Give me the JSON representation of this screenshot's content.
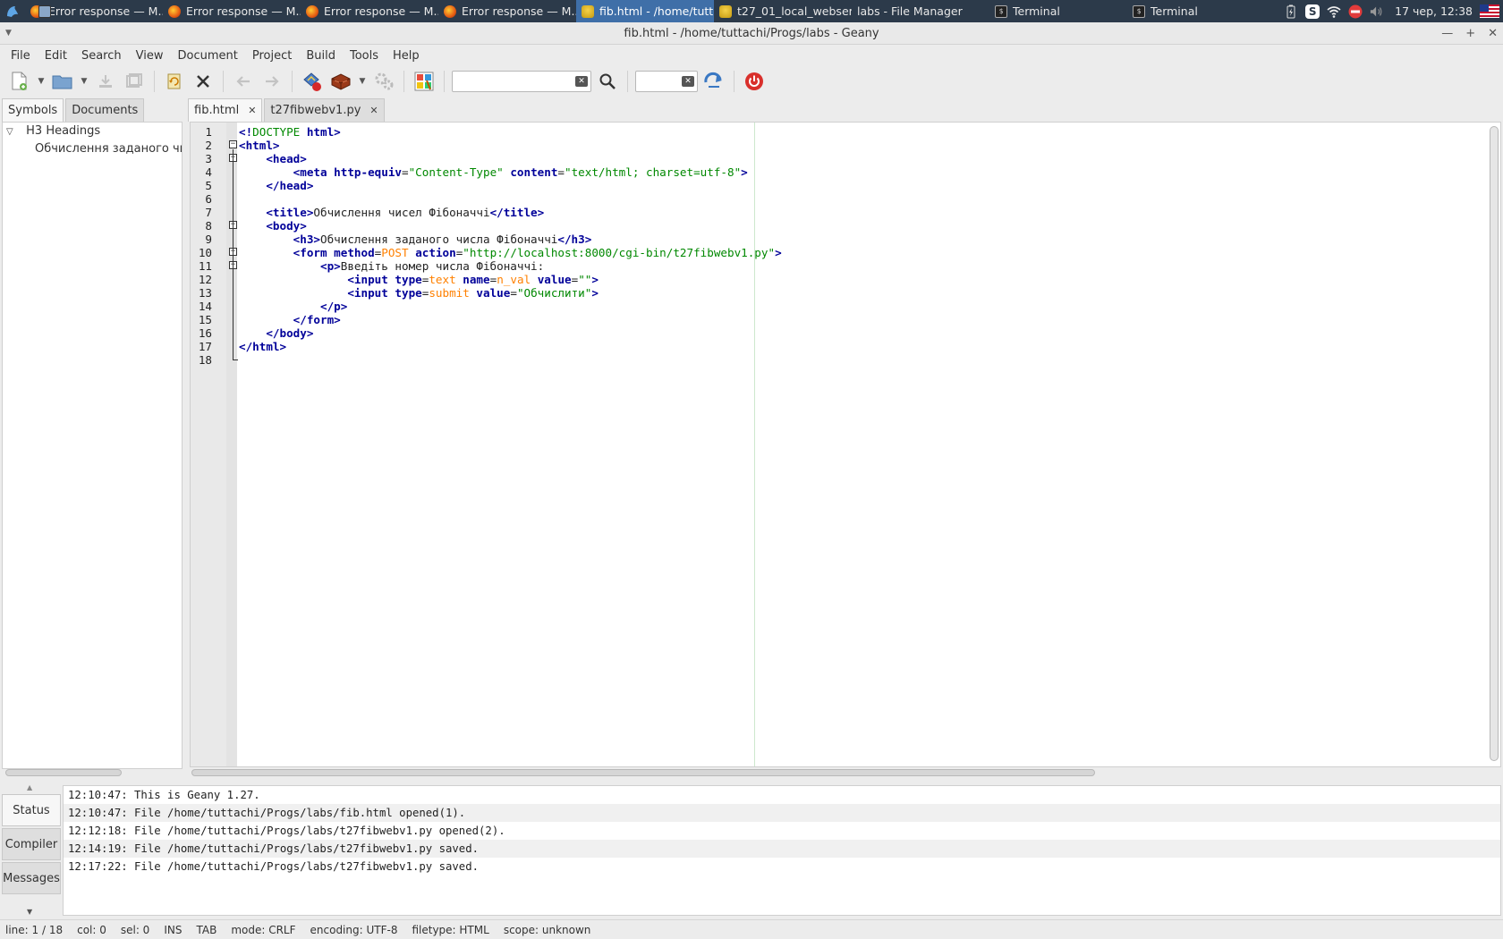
{
  "taskbar": {
    "tasks": [
      {
        "label": "Error response — M...",
        "icon": "firefox-icon"
      },
      {
        "label": "Error response — M...",
        "icon": "firefox-icon"
      },
      {
        "label": "Error response — M...",
        "icon": "firefox-icon"
      },
      {
        "label": "Error response — M...",
        "icon": "firefox-icon"
      },
      {
        "label": "fib.html - /home/tutt...",
        "icon": "geany-icon"
      },
      {
        "label": "t27_01_local_webser...",
        "icon": "geany-icon"
      },
      {
        "label": "labs - File Manager",
        "icon": "folder-icon"
      },
      {
        "label": "Terminal",
        "icon": "terminal-icon"
      },
      {
        "label": "Terminal",
        "icon": "terminal-icon"
      }
    ],
    "clock": "17 чер, 12:38"
  },
  "window": {
    "title": "fib.html - /home/tuttachi/Progs/labs - Geany"
  },
  "menu": [
    "File",
    "Edit",
    "Search",
    "View",
    "Document",
    "Project",
    "Build",
    "Tools",
    "Help"
  ],
  "sidebar": {
    "tabs": [
      "Symbols",
      "Documents"
    ],
    "tree": {
      "group": "H3 Headings",
      "item": "Обчислення заданого числа"
    }
  },
  "editor": {
    "tabs": [
      {
        "label": "fib.html"
      },
      {
        "label": "t27fibwebv1.py"
      }
    ],
    "line_numbers": [
      "1",
      "2",
      "3",
      "4",
      "5",
      "6",
      "7",
      "8",
      "9",
      "10",
      "11",
      "12",
      "13",
      "14",
      "15",
      "16",
      "17",
      "18"
    ]
  },
  "code": {
    "l1a": "<!",
    "l1b": "DOCTYPE",
    "l1c": " html",
    "l1d": ">",
    "l2": "<html>",
    "l3": "<head>",
    "l4a": "<meta",
    "l4b": " http-equiv",
    "l4c": "=",
    "l4d": "\"Content-Type\"",
    "l4e": " content",
    "l4f": "=",
    "l4g": "\"text/html; charset=utf-8\"",
    "l4h": ">",
    "l5": "</head>",
    "l7a": "<title>",
    "l7b": "Обчислення чисел Фібоначчі",
    "l7c": "</title>",
    "l8": "<body>",
    "l9a": "<h3>",
    "l9b": "Обчислення заданого числа Фібоначчі",
    "l9c": "</h3>",
    "l10a": "<form",
    "l10b": " method",
    "l10c": "=",
    "l10d": "POST",
    "l10e": " action",
    "l10f": "=",
    "l10g": "\"http://localhost:8000/cgi-bin/t27fibwebv1.py\"",
    "l10h": ">",
    "l11a": "<p>",
    "l11b": "Введіть номер числа Фібоначчі:",
    "l12a": "<input",
    "l12b": " type",
    "l12c": "=",
    "l12d": "text",
    "l12e": " name",
    "l12f": "=",
    "l12g": "n_val",
    "l12h": " value",
    "l12i": "=",
    "l12j": "\"\"",
    "l12k": ">",
    "l13a": "<input",
    "l13b": " type",
    "l13c": "=",
    "l13d": "submit",
    "l13e": " value",
    "l13f": "=",
    "l13g": "\"Обчислити\"",
    "l13h": ">",
    "l14": "</p>",
    "l15": "</form>",
    "l16": "</body>",
    "l17": "</html>"
  },
  "messages": {
    "tabs": [
      "Status",
      "Compiler",
      "Messages"
    ],
    "lines": [
      "12:10:47: This is Geany 1.27.",
      "12:10:47: File /home/tuttachi/Progs/labs/fib.html opened(1).",
      "12:12:18: File /home/tuttachi/Progs/labs/t27fibwebv1.py opened(2).",
      "12:14:19: File /home/tuttachi/Progs/labs/t27fibwebv1.py saved.",
      "12:17:22: File /home/tuttachi/Progs/labs/t27fibwebv1.py saved."
    ]
  },
  "status": {
    "line": "line: 1 / 18",
    "col": "col: 0",
    "sel": "sel: 0",
    "ins": "INS",
    "tab": "TAB",
    "mode": "mode: CRLF",
    "encoding": "encoding: UTF-8",
    "filetype": "filetype: HTML",
    "scope": "scope: unknown"
  }
}
